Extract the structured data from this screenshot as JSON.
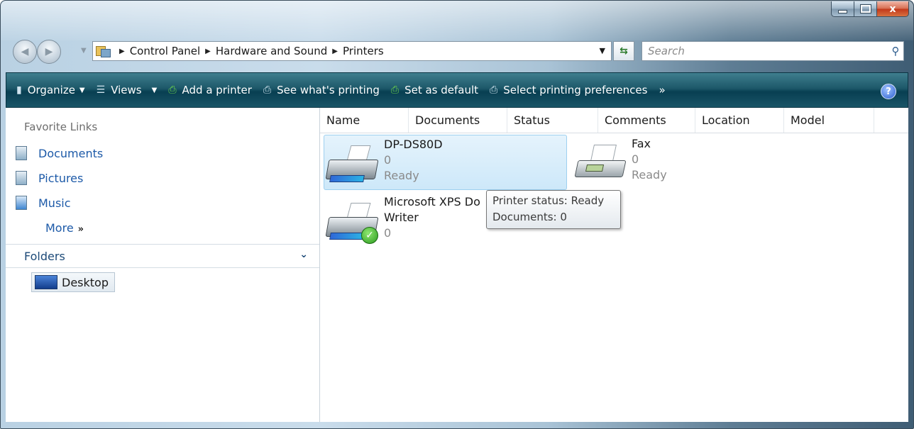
{
  "window": {
    "minimize_icon": "minimize-icon",
    "maximize_icon": "maximize-icon",
    "close_label": "x"
  },
  "address_bar": {
    "crumbs": [
      "Control Panel",
      "Hardware and Sound",
      "Printers"
    ],
    "search_placeholder": "Search"
  },
  "command_bar": {
    "organize": "Organize",
    "views": "Views",
    "add_printer": "Add a printer",
    "see_printing": "See what's printing",
    "set_default": "Set as default",
    "select_prefs": "Select printing preferences",
    "more": "»",
    "help": "?"
  },
  "left_pane": {
    "favorites_title": "Favorite Links",
    "favorites": [
      "Documents",
      "Pictures",
      "Music"
    ],
    "more": "More",
    "folders_label": "Folders",
    "tree_item": "Desktop"
  },
  "columns": [
    "Name",
    "Documents",
    "Status",
    "Comments",
    "Location",
    "Model"
  ],
  "printers": [
    {
      "name": "DP-DS80D",
      "documents": "0",
      "status": "Ready"
    },
    {
      "name": "Fax",
      "documents": "0",
      "status": "Ready"
    },
    {
      "name_line1": "Microsoft XPS Do",
      "name_line2": "Writer",
      "documents": "0"
    }
  ],
  "tooltip": {
    "line1": "Printer status: Ready",
    "line2": "Documents: 0"
  },
  "colors": {
    "command_bar": "#1d5869",
    "link": "#1d5aa8",
    "selection": "#cde8f9"
  }
}
